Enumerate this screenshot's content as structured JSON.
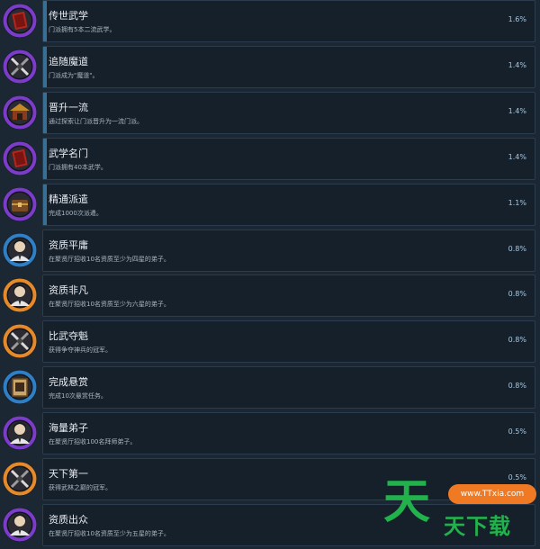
{
  "achievements": [
    {
      "title": "传世武学",
      "description": "门派拥有5本二流武学。",
      "percent": "1.6%",
      "ring_color": "#7b3cc9",
      "icon": "red-book-icon"
    },
    {
      "title": "追随魔道",
      "description": "门派成为\"魔道\"。",
      "percent": "1.4%",
      "ring_color": "#7b3cc9",
      "icon": "crossed-swords-icon"
    },
    {
      "title": "晋升一流",
      "description": "通过探索让门派晋升为一流门派。",
      "percent": "1.4%",
      "ring_color": "#7b3cc9",
      "icon": "pavilion-icon"
    },
    {
      "title": "武学名门",
      "description": "门派拥有40本武学。",
      "percent": "1.4%",
      "ring_color": "#7b3cc9",
      "icon": "red-book-icon"
    },
    {
      "title": "精通派遣",
      "description": "完成1000次派遣。",
      "percent": "1.1%",
      "ring_color": "#7b3cc9",
      "icon": "treasure-chest-icon"
    },
    {
      "title": "资质平庸",
      "description": "在聚贤厅招收10名资质至少为四星的弟子。",
      "percent": "0.8%",
      "ring_color": "#2f7fc6",
      "icon": "disciple-portrait-icon"
    },
    {
      "title": "资质非凡",
      "description": "在聚贤厅招收10名资质至少为六星的弟子。",
      "percent": "0.8%",
      "ring_color": "#e58a2a",
      "icon": "disciple-portrait-icon"
    },
    {
      "title": "比武夺魁",
      "description": "获得争夺神兵的冠军。",
      "percent": "0.8%",
      "ring_color": "#e58a2a",
      "icon": "crossed-swords-icon"
    },
    {
      "title": "完成悬赏",
      "description": "完成10次悬赏任务。",
      "percent": "0.8%",
      "ring_color": "#2f7fc6",
      "icon": "bounty-scroll-icon"
    },
    {
      "title": "海量弟子",
      "description": "在聚贤厅招收100名拜师弟子。",
      "percent": "0.5%",
      "ring_color": "#7b3cc9",
      "icon": "disciple-portrait-icon"
    },
    {
      "title": "天下第一",
      "description": "获得武林之巅的冠军。",
      "percent": "0.5%",
      "ring_color": "#e58a2a",
      "icon": "crossed-swords-icon"
    },
    {
      "title": "资质出众",
      "description": "在聚贤厅招收10名资质至少为五星的弟子。",
      "percent": "",
      "ring_color": "#7b3cc9",
      "icon": "disciple-portrait-icon"
    }
  ],
  "watermark": {
    "big": "天",
    "pill": "www.TTxia.com",
    "small": "天下载",
    "color": "#22b24c",
    "pill_color": "#f07a23"
  }
}
